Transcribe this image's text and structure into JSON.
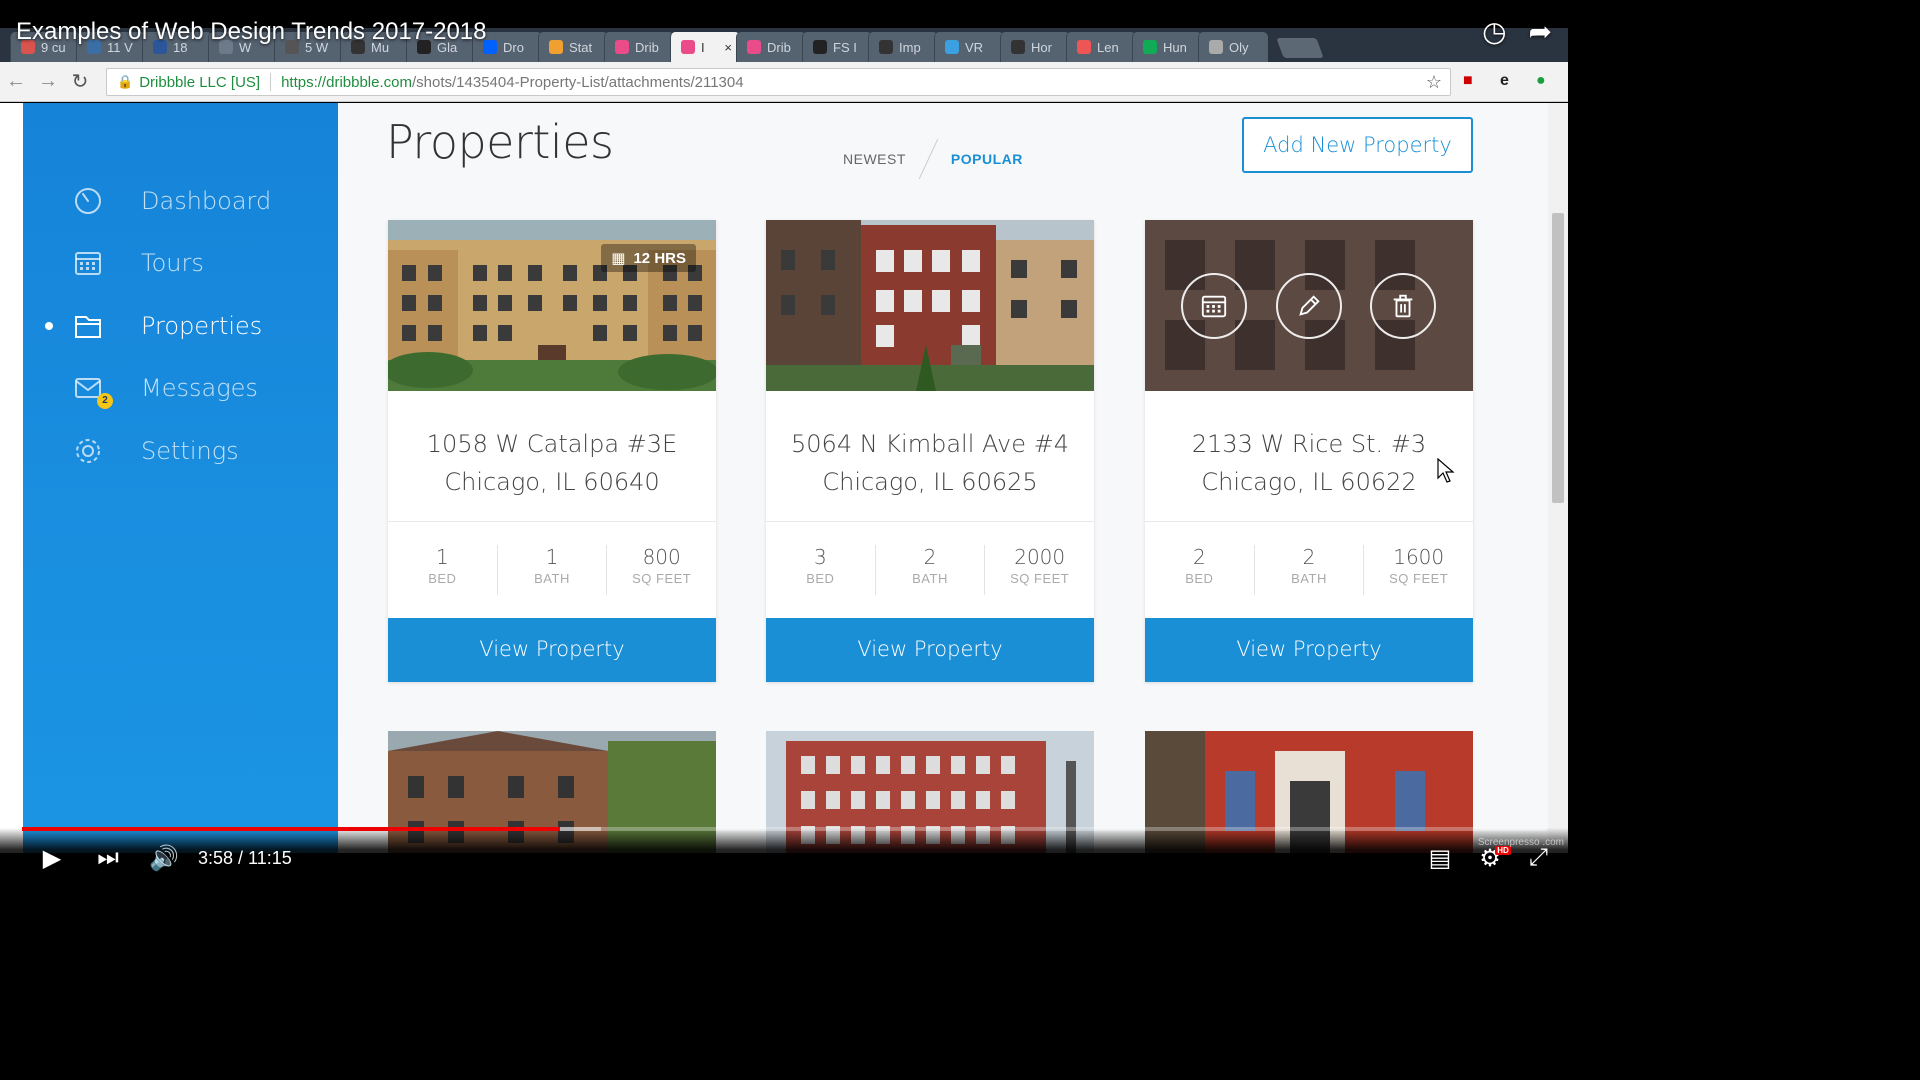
{
  "video": {
    "title": "Examples of Web Design Trends 2017-2018",
    "time_current": "3:58",
    "time_total": "11:15",
    "time_display": "3:58 / 11:15",
    "progress_fraction": 0.353,
    "watermark": "Screenpresso .com"
  },
  "browser": {
    "tabs": [
      {
        "label": "9 cu",
        "color": "#d9534f"
      },
      {
        "label": "11 V",
        "color": "#3b6ea5"
      },
      {
        "label": "18",
        "color": "#2b579a"
      },
      {
        "label": "W",
        "color": "#6c7a89"
      },
      {
        "label": "5 W",
        "color": "#555"
      },
      {
        "label": "Mu",
        "color": "#333"
      },
      {
        "label": "Gla",
        "color": "#222"
      },
      {
        "label": "Dro",
        "color": "#0061ff"
      },
      {
        "label": "Stat",
        "color": "#f0a030"
      },
      {
        "label": "Drib",
        "color": "#ea4c89"
      },
      {
        "label": "I",
        "color": "#ea4c89",
        "active": true
      },
      {
        "label": "Drib",
        "color": "#ea4c89"
      },
      {
        "label": "FS I",
        "color": "#222"
      },
      {
        "label": "Imp",
        "color": "#333"
      },
      {
        "label": "VR",
        "color": "#3aa0e0"
      },
      {
        "label": "Hor",
        "color": "#333"
      },
      {
        "label": "Len",
        "color": "#e55"
      },
      {
        "label": "Hun",
        "color": "#1a5"
      },
      {
        "label": "Oly",
        "color": "#aaa"
      }
    ],
    "site_identity": "Dribbble LLC [US]",
    "url_host": "https://dribbble.com",
    "url_path": "/shots/1435404-Property-List/attachments/211304"
  },
  "sidebar": {
    "items": [
      {
        "label": "Dashboard",
        "icon": "dashboard-icon"
      },
      {
        "label": "Tours",
        "icon": "calendar-icon"
      },
      {
        "label": "Properties",
        "icon": "folder-icon",
        "active": true
      },
      {
        "label": "Messages",
        "icon": "mail-icon",
        "badge": "2"
      },
      {
        "label": "Settings",
        "icon": "gear-icon"
      }
    ]
  },
  "main": {
    "title": "Properties",
    "sort": {
      "newest": "NEWEST",
      "popular": "POPULAR",
      "selected": "POPULAR"
    },
    "add_button": "Add New Property",
    "cards": [
      {
        "address_line1": "1058 W Catalpa #3E",
        "address_line2": "Chicago, IL 60640",
        "bed": "1",
        "bath": "1",
        "sqft": "800",
        "bed_label": "BED",
        "bath_label": "BATH",
        "sqft_label": "SQ FEET",
        "badge": "12 HRS",
        "button": "View Property"
      },
      {
        "address_line1": "5064 N Kimball Ave #4",
        "address_line2": "Chicago, IL 60625",
        "bed": "3",
        "bath": "2",
        "sqft": "2000",
        "bed_label": "BED",
        "bath_label": "BATH",
        "sqft_label": "SQ FEET",
        "button": "View Property"
      },
      {
        "address_line1": "2133 W Rice St. #3",
        "address_line2": "Chicago, IL 60622",
        "bed": "2",
        "bath": "2",
        "sqft": "1600",
        "bed_label": "BED",
        "bath_label": "BATH",
        "sqft_label": "SQ FEET",
        "button": "View Property"
      }
    ]
  },
  "colors": {
    "accent": "#1a8fd6",
    "sidebar_top": "#1583d8",
    "progress": "#ee0000"
  }
}
